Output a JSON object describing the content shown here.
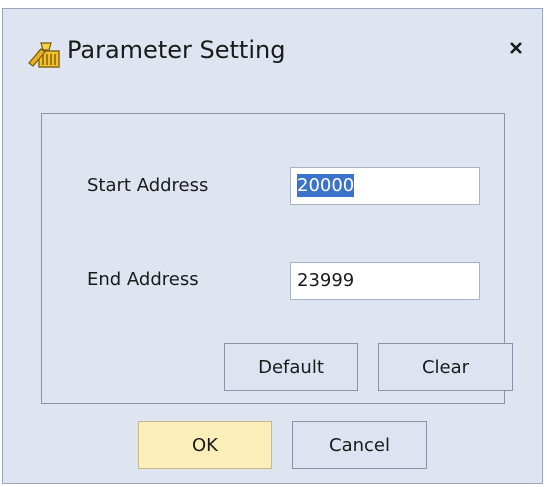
{
  "dialog": {
    "title": "Parameter Setting",
    "close_glyph": "×",
    "icon": "parameter-settings-icon"
  },
  "fields": {
    "start_label": "Start Address",
    "start_value": "20000",
    "end_label": "End Address",
    "end_value": "23999"
  },
  "buttons": {
    "default_label": "Default",
    "clear_label": "Clear",
    "ok_label": "OK",
    "cancel_label": "Cancel"
  },
  "colors": {
    "dialog_bg": "#dfe4f1",
    "primary_button": "#fbeeb9",
    "selection": "#3a73c9"
  }
}
